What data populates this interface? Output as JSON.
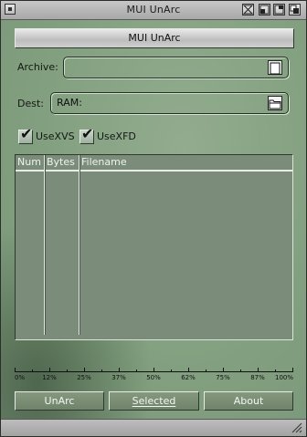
{
  "window": {
    "title": "MUI UnArc"
  },
  "title_button": {
    "label": "MUI UnArc"
  },
  "archive": {
    "label": "Archive:",
    "value": ""
  },
  "dest": {
    "label": "Dest:",
    "value": "RAM:"
  },
  "options": {
    "usexvs": {
      "label": "UseXVS",
      "checked": true
    },
    "usexfd": {
      "label": "UseXFD",
      "checked": true
    }
  },
  "list": {
    "columns": [
      "Num",
      "Bytes",
      "Filename"
    ],
    "rows": []
  },
  "progress": {
    "value_percent": 0,
    "scale_labels": [
      "0%",
      "12%",
      "25%",
      "37%",
      "50%",
      "62%",
      "75%",
      "87%",
      "100%"
    ]
  },
  "buttons": {
    "unarc": "UnArc",
    "selected": "Selected",
    "about": "About"
  },
  "colors": {
    "window_bg": "#82a07f",
    "list_bg": "#7b8c7b",
    "button_bg": "#7a8e75"
  }
}
